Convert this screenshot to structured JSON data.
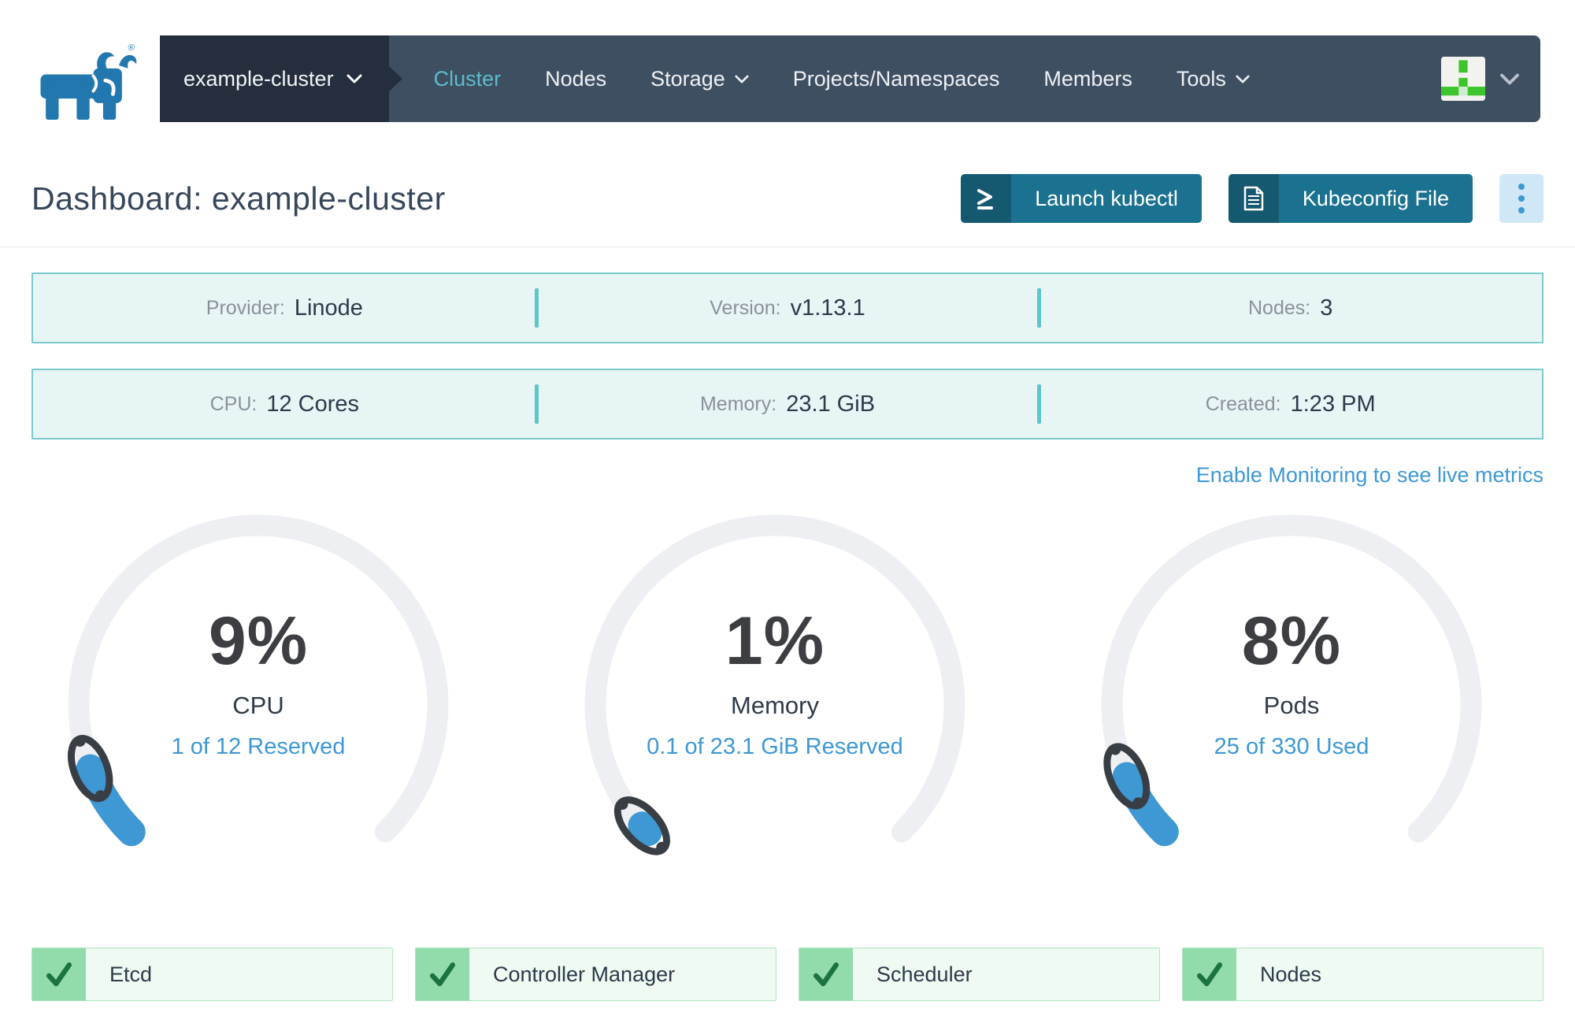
{
  "nav": {
    "cluster_selector": "example-cluster",
    "items": [
      {
        "label": "Cluster",
        "active": true
      },
      {
        "label": "Nodes"
      },
      {
        "label": "Storage",
        "dropdown": true
      },
      {
        "label": "Projects/Namespaces"
      },
      {
        "label": "Members"
      },
      {
        "label": "Tools",
        "dropdown": true
      }
    ]
  },
  "header": {
    "title": "Dashboard: example-cluster",
    "launch_kubectl_label": "Launch kubectl",
    "kubeconfig_label": "Kubeconfig File"
  },
  "info_rows": [
    {
      "cells": [
        {
          "label": "Provider:",
          "value": "Linode"
        },
        {
          "label": "Version:",
          "value": "v1.13.1"
        },
        {
          "label": "Nodes:",
          "value": "3"
        }
      ]
    },
    {
      "cells": [
        {
          "label": "CPU:",
          "value": "12 Cores"
        },
        {
          "label": "Memory:",
          "value": "23.1 GiB"
        },
        {
          "label": "Created:",
          "value": "1:23 PM"
        }
      ]
    }
  ],
  "monitoring_link": "Enable Monitoring to see live metrics",
  "gauges": [
    {
      "percent": 9,
      "percent_label": "9%",
      "label": "CPU",
      "detail": "1 of 12 Reserved"
    },
    {
      "percent": 1,
      "percent_label": "1%",
      "label": "Memory",
      "detail": "0.1 of 23.1 GiB Reserved"
    },
    {
      "percent": 8,
      "percent_label": "8%",
      "label": "Pods",
      "detail": "25 of 330 Used"
    }
  ],
  "statuses": [
    {
      "label": "Etcd"
    },
    {
      "label": "Controller Manager"
    },
    {
      "label": "Scheduler"
    },
    {
      "label": "Nodes"
    }
  ],
  "colors": {
    "accent": "#3d98d3",
    "track": "#edeff2",
    "loop": "#393e44",
    "nav_dark": "#242e3c",
    "nav_light": "#3f4f62",
    "nav_active": "#5bbccb",
    "button_teal": "#1b7190",
    "info_border": "#7acacd",
    "status_green": "#92dcac"
  }
}
